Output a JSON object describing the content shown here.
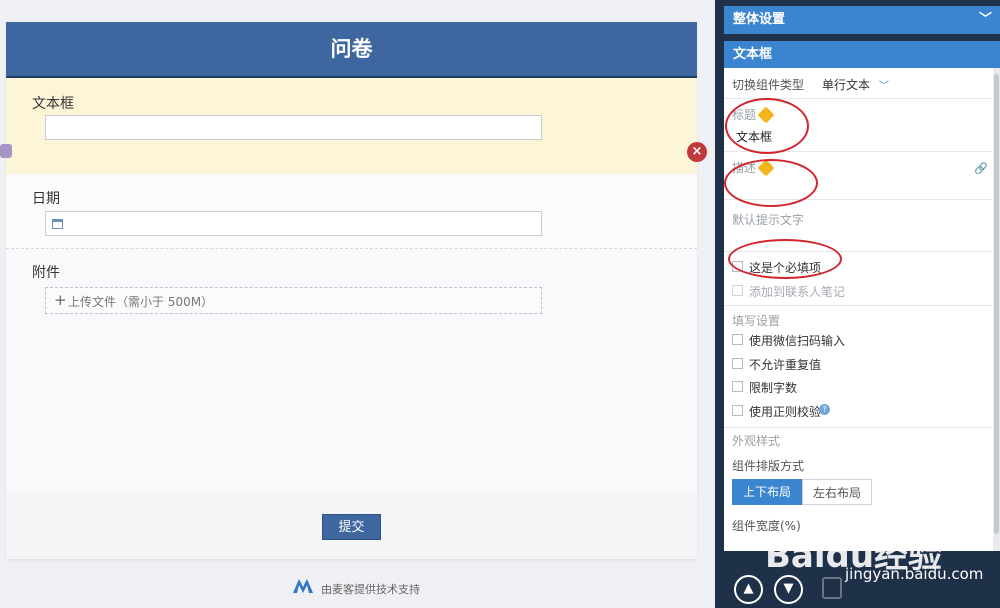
{
  "form": {
    "title": "问卷",
    "fields": [
      {
        "label": "文本框",
        "type": "text"
      },
      {
        "label": "日期",
        "type": "date"
      },
      {
        "label": "附件",
        "type": "upload",
        "upload_text": "上传文件（需小于 500M）"
      }
    ],
    "submit_label": "提交",
    "footer_text": "由麦客提供技术支持"
  },
  "panel": {
    "overall_settings": "整体设置",
    "section_title": "文本框",
    "switch_type_label": "切换组件类型",
    "switch_type_value": "单行文本",
    "title_label": "标题",
    "title_value": "文本框",
    "description_label": "描述",
    "default_hint_label": "默认提示文字",
    "required_label": "这是个必填项",
    "add_contact_label": "添加到联系人笔记",
    "fill_settings_label": "填写设置",
    "options": [
      "使用微信扫码输入",
      "不允许重复值",
      "限制字数",
      "使用正则校验"
    ],
    "appearance_label": "外观样式",
    "layout_label": "组件排版方式",
    "layout_vertical": "上下布局",
    "layout_horizontal": "左右布局",
    "width_label": "组件宽度(%)"
  },
  "watermark": {
    "brand": "Baidu经验",
    "url": "jingyan.baidu.com"
  },
  "colors": {
    "header": "#3e67a0",
    "accent": "#3b85d0",
    "highlight": "#fdf5d8",
    "annotation": "#d3252c"
  }
}
